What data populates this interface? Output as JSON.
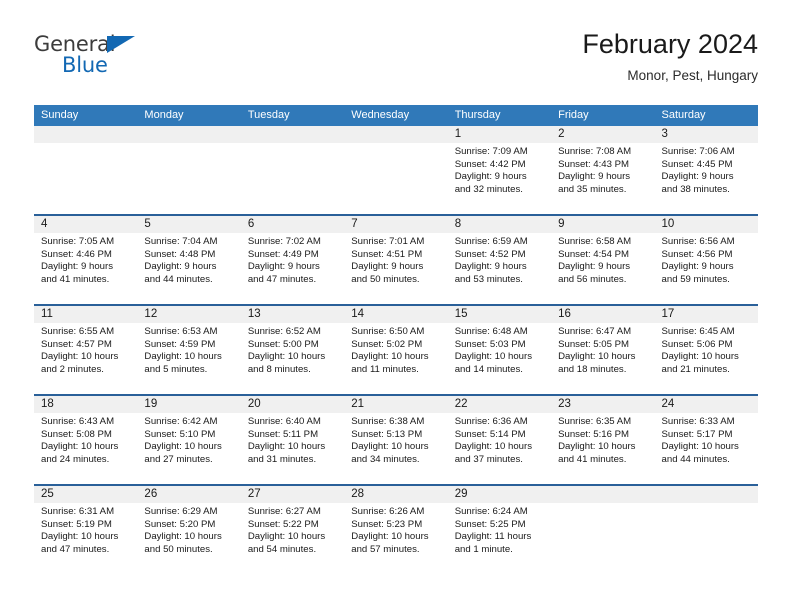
{
  "brand": {
    "name_part1": "General",
    "name_part2": "Blue",
    "flag_icon": "triangle-flag-icon"
  },
  "header": {
    "title": "February 2024",
    "subtitle": "Monor, Pest, Hungary"
  },
  "colors": {
    "header_blue": "#3079b9",
    "row_divider_blue": "#2a6099",
    "day_band_gray": "#f0f0f0",
    "brand_blue": "#1268b3"
  },
  "weekdays": [
    "Sunday",
    "Monday",
    "Tuesday",
    "Wednesday",
    "Thursday",
    "Friday",
    "Saturday"
  ],
  "weeks": [
    [
      {
        "day": "",
        "lines": []
      },
      {
        "day": "",
        "lines": []
      },
      {
        "day": "",
        "lines": []
      },
      {
        "day": "",
        "lines": []
      },
      {
        "day": "1",
        "lines": [
          "Sunrise: 7:09 AM",
          "Sunset: 4:42 PM",
          "Daylight: 9 hours",
          "and 32 minutes."
        ]
      },
      {
        "day": "2",
        "lines": [
          "Sunrise: 7:08 AM",
          "Sunset: 4:43 PM",
          "Daylight: 9 hours",
          "and 35 minutes."
        ]
      },
      {
        "day": "3",
        "lines": [
          "Sunrise: 7:06 AM",
          "Sunset: 4:45 PM",
          "Daylight: 9 hours",
          "and 38 minutes."
        ]
      }
    ],
    [
      {
        "day": "4",
        "lines": [
          "Sunrise: 7:05 AM",
          "Sunset: 4:46 PM",
          "Daylight: 9 hours",
          "and 41 minutes."
        ]
      },
      {
        "day": "5",
        "lines": [
          "Sunrise: 7:04 AM",
          "Sunset: 4:48 PM",
          "Daylight: 9 hours",
          "and 44 minutes."
        ]
      },
      {
        "day": "6",
        "lines": [
          "Sunrise: 7:02 AM",
          "Sunset: 4:49 PM",
          "Daylight: 9 hours",
          "and 47 minutes."
        ]
      },
      {
        "day": "7",
        "lines": [
          "Sunrise: 7:01 AM",
          "Sunset: 4:51 PM",
          "Daylight: 9 hours",
          "and 50 minutes."
        ]
      },
      {
        "day": "8",
        "lines": [
          "Sunrise: 6:59 AM",
          "Sunset: 4:52 PM",
          "Daylight: 9 hours",
          "and 53 minutes."
        ]
      },
      {
        "day": "9",
        "lines": [
          "Sunrise: 6:58 AM",
          "Sunset: 4:54 PM",
          "Daylight: 9 hours",
          "and 56 minutes."
        ]
      },
      {
        "day": "10",
        "lines": [
          "Sunrise: 6:56 AM",
          "Sunset: 4:56 PM",
          "Daylight: 9 hours",
          "and 59 minutes."
        ]
      }
    ],
    [
      {
        "day": "11",
        "lines": [
          "Sunrise: 6:55 AM",
          "Sunset: 4:57 PM",
          "Daylight: 10 hours",
          "and 2 minutes."
        ]
      },
      {
        "day": "12",
        "lines": [
          "Sunrise: 6:53 AM",
          "Sunset: 4:59 PM",
          "Daylight: 10 hours",
          "and 5 minutes."
        ]
      },
      {
        "day": "13",
        "lines": [
          "Sunrise: 6:52 AM",
          "Sunset: 5:00 PM",
          "Daylight: 10 hours",
          "and 8 minutes."
        ]
      },
      {
        "day": "14",
        "lines": [
          "Sunrise: 6:50 AM",
          "Sunset: 5:02 PM",
          "Daylight: 10 hours",
          "and 11 minutes."
        ]
      },
      {
        "day": "15",
        "lines": [
          "Sunrise: 6:48 AM",
          "Sunset: 5:03 PM",
          "Daylight: 10 hours",
          "and 14 minutes."
        ]
      },
      {
        "day": "16",
        "lines": [
          "Sunrise: 6:47 AM",
          "Sunset: 5:05 PM",
          "Daylight: 10 hours",
          "and 18 minutes."
        ]
      },
      {
        "day": "17",
        "lines": [
          "Sunrise: 6:45 AM",
          "Sunset: 5:06 PM",
          "Daylight: 10 hours",
          "and 21 minutes."
        ]
      }
    ],
    [
      {
        "day": "18",
        "lines": [
          "Sunrise: 6:43 AM",
          "Sunset: 5:08 PM",
          "Daylight: 10 hours",
          "and 24 minutes."
        ]
      },
      {
        "day": "19",
        "lines": [
          "Sunrise: 6:42 AM",
          "Sunset: 5:10 PM",
          "Daylight: 10 hours",
          "and 27 minutes."
        ]
      },
      {
        "day": "20",
        "lines": [
          "Sunrise: 6:40 AM",
          "Sunset: 5:11 PM",
          "Daylight: 10 hours",
          "and 31 minutes."
        ]
      },
      {
        "day": "21",
        "lines": [
          "Sunrise: 6:38 AM",
          "Sunset: 5:13 PM",
          "Daylight: 10 hours",
          "and 34 minutes."
        ]
      },
      {
        "day": "22",
        "lines": [
          "Sunrise: 6:36 AM",
          "Sunset: 5:14 PM",
          "Daylight: 10 hours",
          "and 37 minutes."
        ]
      },
      {
        "day": "23",
        "lines": [
          "Sunrise: 6:35 AM",
          "Sunset: 5:16 PM",
          "Daylight: 10 hours",
          "and 41 minutes."
        ]
      },
      {
        "day": "24",
        "lines": [
          "Sunrise: 6:33 AM",
          "Sunset: 5:17 PM",
          "Daylight: 10 hours",
          "and 44 minutes."
        ]
      }
    ],
    [
      {
        "day": "25",
        "lines": [
          "Sunrise: 6:31 AM",
          "Sunset: 5:19 PM",
          "Daylight: 10 hours",
          "and 47 minutes."
        ]
      },
      {
        "day": "26",
        "lines": [
          "Sunrise: 6:29 AM",
          "Sunset: 5:20 PM",
          "Daylight: 10 hours",
          "and 50 minutes."
        ]
      },
      {
        "day": "27",
        "lines": [
          "Sunrise: 6:27 AM",
          "Sunset: 5:22 PM",
          "Daylight: 10 hours",
          "and 54 minutes."
        ]
      },
      {
        "day": "28",
        "lines": [
          "Sunrise: 6:26 AM",
          "Sunset: 5:23 PM",
          "Daylight: 10 hours",
          "and 57 minutes."
        ]
      },
      {
        "day": "29",
        "lines": [
          "Sunrise: 6:24 AM",
          "Sunset: 5:25 PM",
          "Daylight: 11 hours",
          "and 1 minute."
        ]
      },
      {
        "day": "",
        "lines": []
      },
      {
        "day": "",
        "lines": []
      }
    ]
  ]
}
